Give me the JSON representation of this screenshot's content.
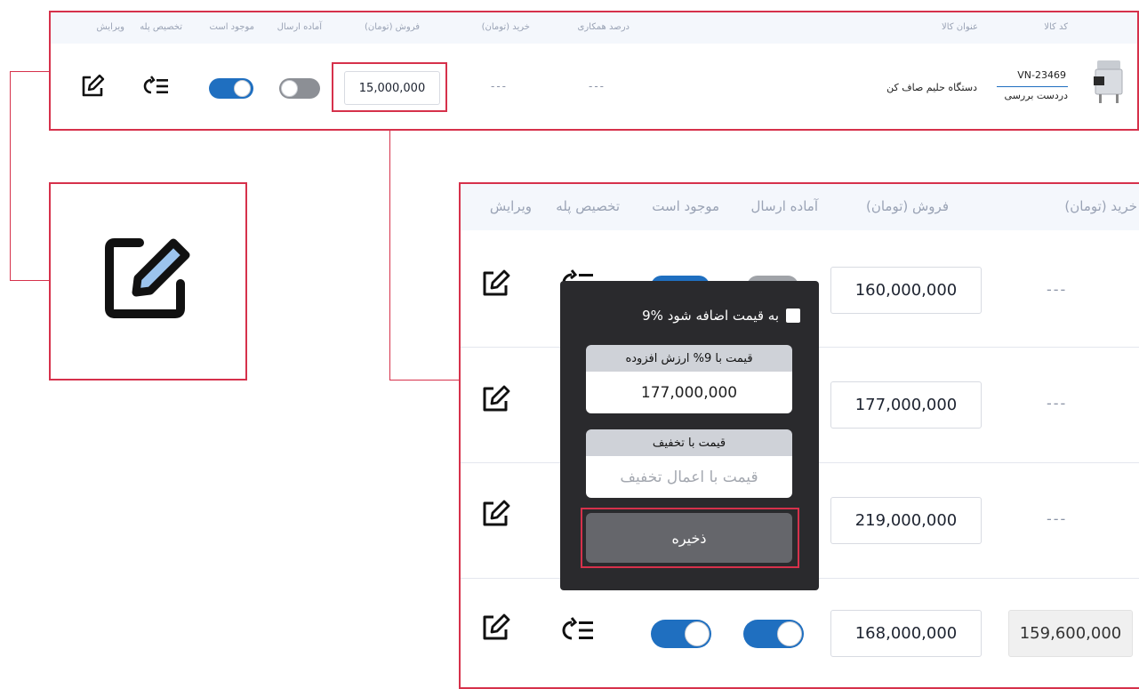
{
  "top_table": {
    "headers": {
      "code": "کد کالا",
      "title": "عنوان کالا",
      "commission": "درصد همکاری",
      "buy": "خرید (تومان)",
      "sell": "فروش (تومان)",
      "ready": "آماده ارسال",
      "available": "موجود است",
      "tier": "تخصیص پله",
      "edit": "ویرایش"
    },
    "row": {
      "code": "VN-23469",
      "status": "دردست بررسی",
      "title": "دستگاه حلیم صاف کن",
      "commission": "---",
      "buy": "---",
      "sell": "15,000,000",
      "ready_toggle": "off",
      "available_toggle": "on"
    }
  },
  "zoom_table": {
    "headers": {
      "buy": "خرید (تومان)",
      "sell": "فروش (تومان)",
      "ready": "آماده ارسال",
      "available": "موجود است",
      "tier": "تخصیص پله",
      "edit": "ویرایش"
    },
    "rows": [
      {
        "sell": "160,000,000",
        "buy": "---"
      },
      {
        "sell": "177,000,000",
        "buy": "---"
      },
      {
        "sell": "219,000,000",
        "buy": "---"
      },
      {
        "sell": "168,000,000",
        "buy": "159,600,000",
        "ready_toggle": "on",
        "available_toggle": "on"
      }
    ]
  },
  "popup": {
    "checkbox_label": "9% به قیمت اضافه شود",
    "vat_label": "قیمت با 9% ارزش افزوده",
    "vat_value": "177,000,000",
    "discount_label": "قیمت با تخفیف",
    "discount_placeholder": "قیمت با اعمال تخفیف",
    "save_label": "ذخیره"
  },
  "colors": {
    "accent_red": "#d6314b",
    "toggle_on": "#1f6fc0",
    "toggle_off": "#8c8f95",
    "popup_bg": "#2a2a2d"
  },
  "icons": {
    "edit": "edit-icon",
    "tier": "tier-list-icon",
    "product": "product-image"
  }
}
